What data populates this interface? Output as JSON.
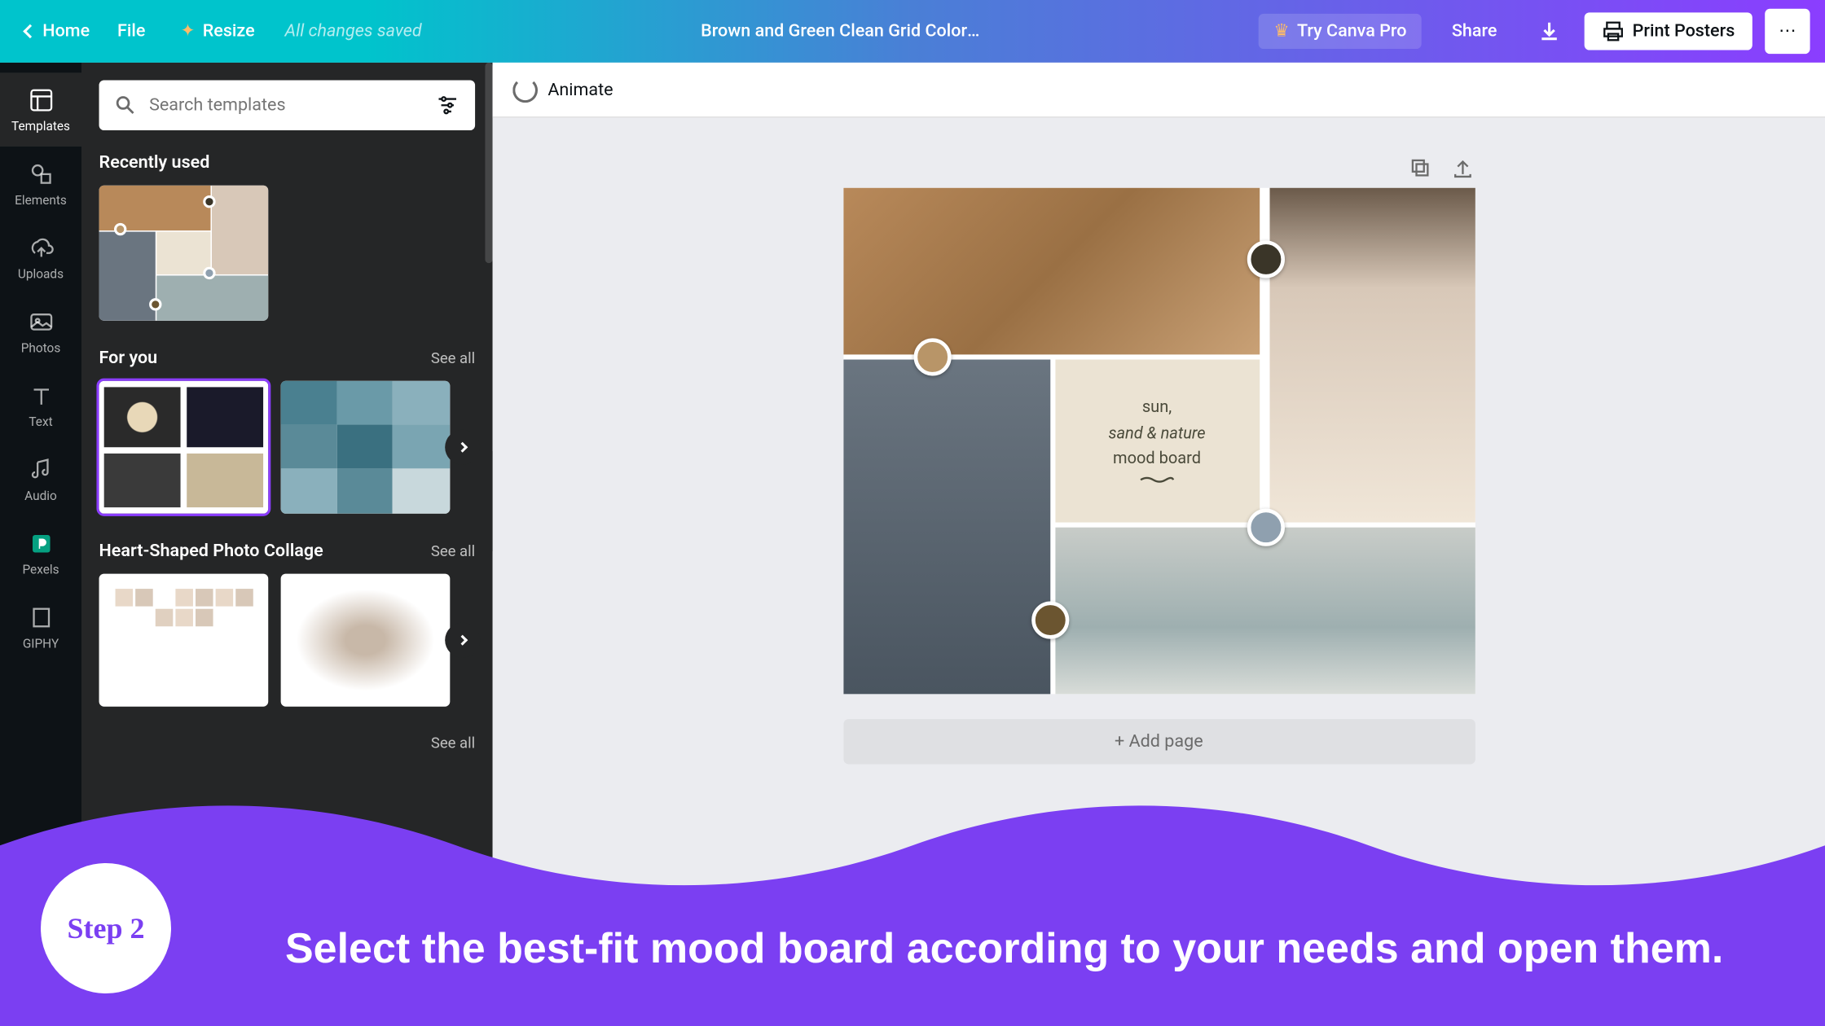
{
  "topbar": {
    "home": "Home",
    "file": "File",
    "resize": "Resize",
    "saved": "All changes saved",
    "title": "Brown and Green Clean Grid Color Inspiration Moodboard ...",
    "pro": "Try Canva Pro",
    "share": "Share",
    "print": "Print Posters"
  },
  "rail": [
    {
      "label": "Templates",
      "icon": "templates",
      "active": true
    },
    {
      "label": "Elements",
      "icon": "elements"
    },
    {
      "label": "Uploads",
      "icon": "uploads"
    },
    {
      "label": "Photos",
      "icon": "photos"
    },
    {
      "label": "Text",
      "icon": "text"
    },
    {
      "label": "Audio",
      "icon": "audio"
    },
    {
      "label": "Pexels",
      "icon": "pexels"
    },
    {
      "label": "GIPHY",
      "icon": "giphy"
    }
  ],
  "search": {
    "placeholder": "Search templates"
  },
  "sections": {
    "recent": {
      "title": "Recently used"
    },
    "foryou": {
      "title": "For you",
      "see": "See all"
    },
    "heart": {
      "title": "Heart-Shaped Photo Collage",
      "see": "See all"
    },
    "more": {
      "see": "See all"
    }
  },
  "toolbar": {
    "animate": "Animate"
  },
  "moodboard": {
    "line1": "sun,",
    "line2": "sand & nature",
    "line3": "mood board",
    "swatches": [
      "#3a3528",
      "#b89568",
      "#8fa0af",
      "#6b5530"
    ]
  },
  "addpage": "+ Add page",
  "overlay": {
    "step": "Step 2",
    "text": "Select the best-fit mood board according to your needs and open them."
  }
}
